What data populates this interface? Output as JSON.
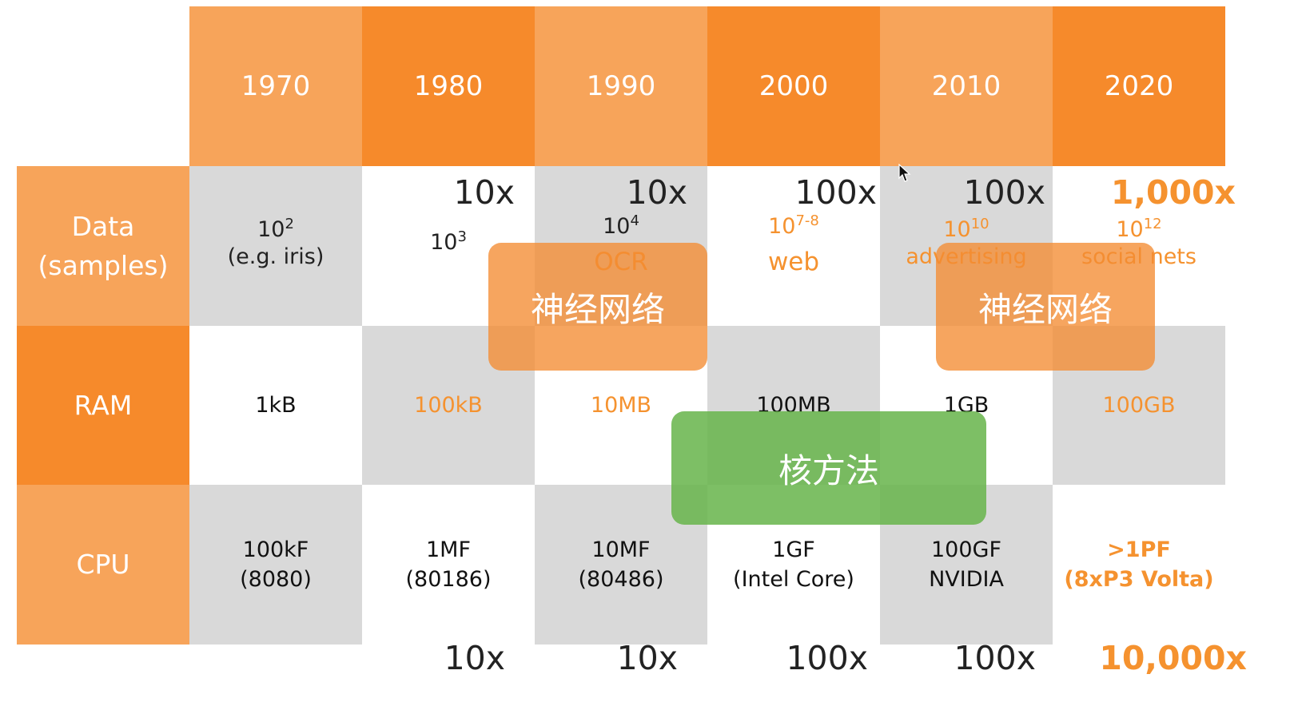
{
  "colors": {
    "header_light": "#f7a45a",
    "header_dark": "#f68a2b",
    "cell_gray": "#d9d9d9",
    "cell_white": "#ffffff",
    "text_orange": "#f5922f",
    "overlay_orange": "#f48c32",
    "overlay_green": "#68b44c"
  },
  "years": [
    "1970",
    "1980",
    "1990",
    "2000",
    "2010",
    "2020"
  ],
  "row_labels": [
    "Data\n(samples)",
    "RAM",
    "CPU"
  ],
  "data_multipliers": [
    "10x",
    "10x",
    "100x",
    "100x",
    "1,000x"
  ],
  "cpu_multipliers": [
    "10x",
    "10x",
    "100x",
    "100x",
    "10,000x"
  ],
  "data_row": [
    {
      "base": "10",
      "exp": "2",
      "note": "(e.g. iris)"
    },
    {
      "base": "10",
      "exp": "3",
      "note": ""
    },
    {
      "base": "10",
      "exp": "4",
      "note": "OCR"
    },
    {
      "base": "10",
      "exp": "7-8",
      "note": "web"
    },
    {
      "base": "10",
      "exp": "10",
      "note": "advertising"
    },
    {
      "base": "10",
      "exp": "12",
      "note": "social nets"
    }
  ],
  "ram_row": [
    "1kB",
    "100kB",
    "10MB",
    "100MB",
    "1GB",
    "100GB"
  ],
  "cpu_row": [
    "100kF\n(8080)",
    "1MF\n(80186)",
    "10MF\n(80486)",
    "1GF\n(Intel Core)",
    "100GF\nNVIDIA",
    ">1PF\n(8xP3 Volta)"
  ],
  "overlays": {
    "neural_net_1": "神经网络",
    "neural_net_2": "神经网络",
    "kernel_methods": "核方法"
  },
  "cursor_icon": "mouse-pointer-icon"
}
